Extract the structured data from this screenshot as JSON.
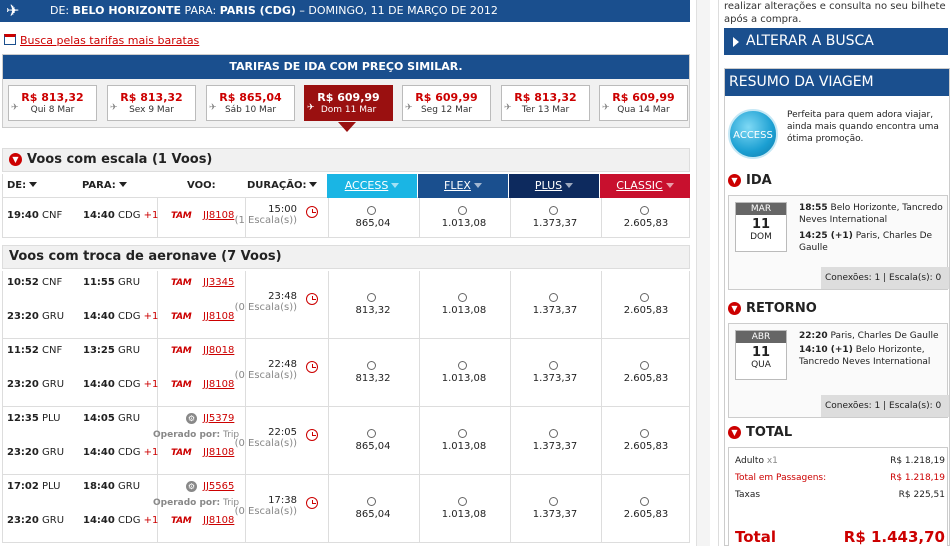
{
  "header": {
    "prefix": "DE:",
    "origin": "BELO HORIZONTE",
    "para": "PARA:",
    "destination": "PARIS (CDG)",
    "date": "– DOMINGO, 11 DE MARÇO DE 2012"
  },
  "cheapest_link": "Busca pelas tarifas mais baratas",
  "fares": {
    "title": "TARIFAS DE IDA COM PREÇO SIMILAR.",
    "items": [
      {
        "price": "R$ 813,32",
        "day": "Qui 8 Mar"
      },
      {
        "price": "R$ 813,32",
        "day": "Sex 9 Mar"
      },
      {
        "price": "R$ 865,04",
        "day": "Sáb 10 Mar"
      },
      {
        "price": "R$ 609,99",
        "day": "Dom 11 Mar"
      },
      {
        "price": "R$ 609,99",
        "day": "Seg 12 Mar"
      },
      {
        "price": "R$ 813,32",
        "day": "Ter 13 Mar"
      },
      {
        "price": "R$ 609,99",
        "day": "Qua 14 Mar"
      }
    ],
    "selected_index": 3
  },
  "sections": {
    "escala": "Voos com escala (1 Voos)",
    "troca": "Voos com troca de aeronave (7 Voos)"
  },
  "columns": {
    "de": "DE:",
    "para": "PARA:",
    "voo": "VOO:",
    "duracao": "DURAÇÃO:",
    "classes": [
      "ACCESS",
      "FLEX",
      "PLUS",
      "CLASSIC"
    ]
  },
  "class_colors": [
    "#1ab5e4",
    "#1a4f8e",
    "#0d2a5e",
    "#c8102e"
  ],
  "rows": [
    {
      "legs": [
        {
          "dep": "19:40",
          "dep_ap": "CNF",
          "arr": "14:40",
          "arr_ap": "CDG",
          "plus": "+1",
          "airline": "TAM",
          "flight": "JJ8108"
        }
      ],
      "duration": "15:00",
      "stops": "(1 Escala(s))",
      "prices": [
        "865,04",
        "1.013,08",
        "1.373,37",
        "2.605,83"
      ]
    },
    {
      "legs": [
        {
          "dep": "10:52",
          "dep_ap": "CNF",
          "arr": "11:55",
          "arr_ap": "GRU",
          "plus": "",
          "airline": "TAM",
          "flight": "JJ3345"
        },
        {
          "dep": "23:20",
          "dep_ap": "GRU",
          "arr": "14:40",
          "arr_ap": "CDG",
          "plus": "+1",
          "airline": "TAM",
          "flight": "JJ8108"
        }
      ],
      "duration": "23:48",
      "stops": "(0 Escala(s))",
      "prices": [
        "813,32",
        "1.013,08",
        "1.373,37",
        "2.605,83"
      ]
    },
    {
      "legs": [
        {
          "dep": "11:52",
          "dep_ap": "CNF",
          "arr": "13:25",
          "arr_ap": "GRU",
          "plus": "",
          "airline": "TAM",
          "flight": "JJ8018"
        },
        {
          "dep": "23:20",
          "dep_ap": "GRU",
          "arr": "14:40",
          "arr_ap": "CDG",
          "plus": "+1",
          "airline": "TAM",
          "flight": "JJ8108"
        }
      ],
      "duration": "22:48",
      "stops": "(0 Escala(s))",
      "prices": [
        "813,32",
        "1.013,08",
        "1.373,37",
        "2.605,83"
      ]
    },
    {
      "legs": [
        {
          "dep": "12:35",
          "dep_ap": "PLU",
          "arr": "14:05",
          "arr_ap": "GRU",
          "plus": "",
          "airline": "",
          "flight": "JJ5379",
          "operated_label": "Operado por:",
          "operated": "Trip"
        },
        {
          "dep": "23:20",
          "dep_ap": "GRU",
          "arr": "14:40",
          "arr_ap": "CDG",
          "plus": "+1",
          "airline": "TAM",
          "flight": "JJ8108"
        }
      ],
      "duration": "22:05",
      "stops": "(0 Escala(s))",
      "prices": [
        "865,04",
        "1.013,08",
        "1.373,37",
        "2.605,83"
      ]
    },
    {
      "legs": [
        {
          "dep": "17:02",
          "dep_ap": "PLU",
          "arr": "18:40",
          "arr_ap": "GRU",
          "plus": "",
          "airline": "",
          "flight": "JJ5565",
          "operated_label": "Operado por:",
          "operated": "Trip"
        },
        {
          "dep": "23:20",
          "dep_ap": "GRU",
          "arr": "14:40",
          "arr_ap": "CDG",
          "plus": "+1",
          "airline": "TAM",
          "flight": "JJ8108"
        }
      ],
      "duration": "17:38",
      "stops": "(0 Escala(s))",
      "prices": [
        "865,04",
        "1.013,08",
        "1.373,37",
        "2.605,83"
      ]
    }
  ],
  "sidebar": {
    "note": "realizar alterações e consulta no seu bilhete após a compra.",
    "alterar": "ALTERAR A BUSCA",
    "resumo": "RESUMO DA VIAGEM",
    "access_badge": "ACCESS",
    "access_text": "Perfeita para quem adora viajar, ainda mais quando encontra uma ótima promoção.",
    "ida": {
      "title": "IDA",
      "month": "MAR",
      "day": "11",
      "weekday": "DOM",
      "dep": "18:55",
      "dep_place": "Belo Horizonte, Tancredo Neves International",
      "arr": "14:25 (+1)",
      "arr_place": "Paris, Charles De Gaulle",
      "conexoes": "Conexões: 1 | Escala(s): 0"
    },
    "retorno": {
      "title": "RETORNO",
      "month": "ABR",
      "day": "11",
      "weekday": "QUA",
      "dep": "22:20",
      "dep_place": "Paris, Charles De Gaulle",
      "arr": "14:10 (+1)",
      "arr_place": "Belo Horizonte, Tancredo Neves International",
      "conexoes": "Conexões: 1 | Escala(s): 0"
    },
    "total": {
      "title": "TOTAL",
      "adulto": "Adulto",
      "adulto_x": "x1",
      "adulto_v": "R$  1.218,19",
      "passagens": "Total em Passagens:",
      "passagens_v": "R$ 1.218,19",
      "taxas": "Taxas",
      "taxas_v": "R$  225,51",
      "grand": "Total",
      "grand_v": "R$  1.443,70"
    }
  }
}
